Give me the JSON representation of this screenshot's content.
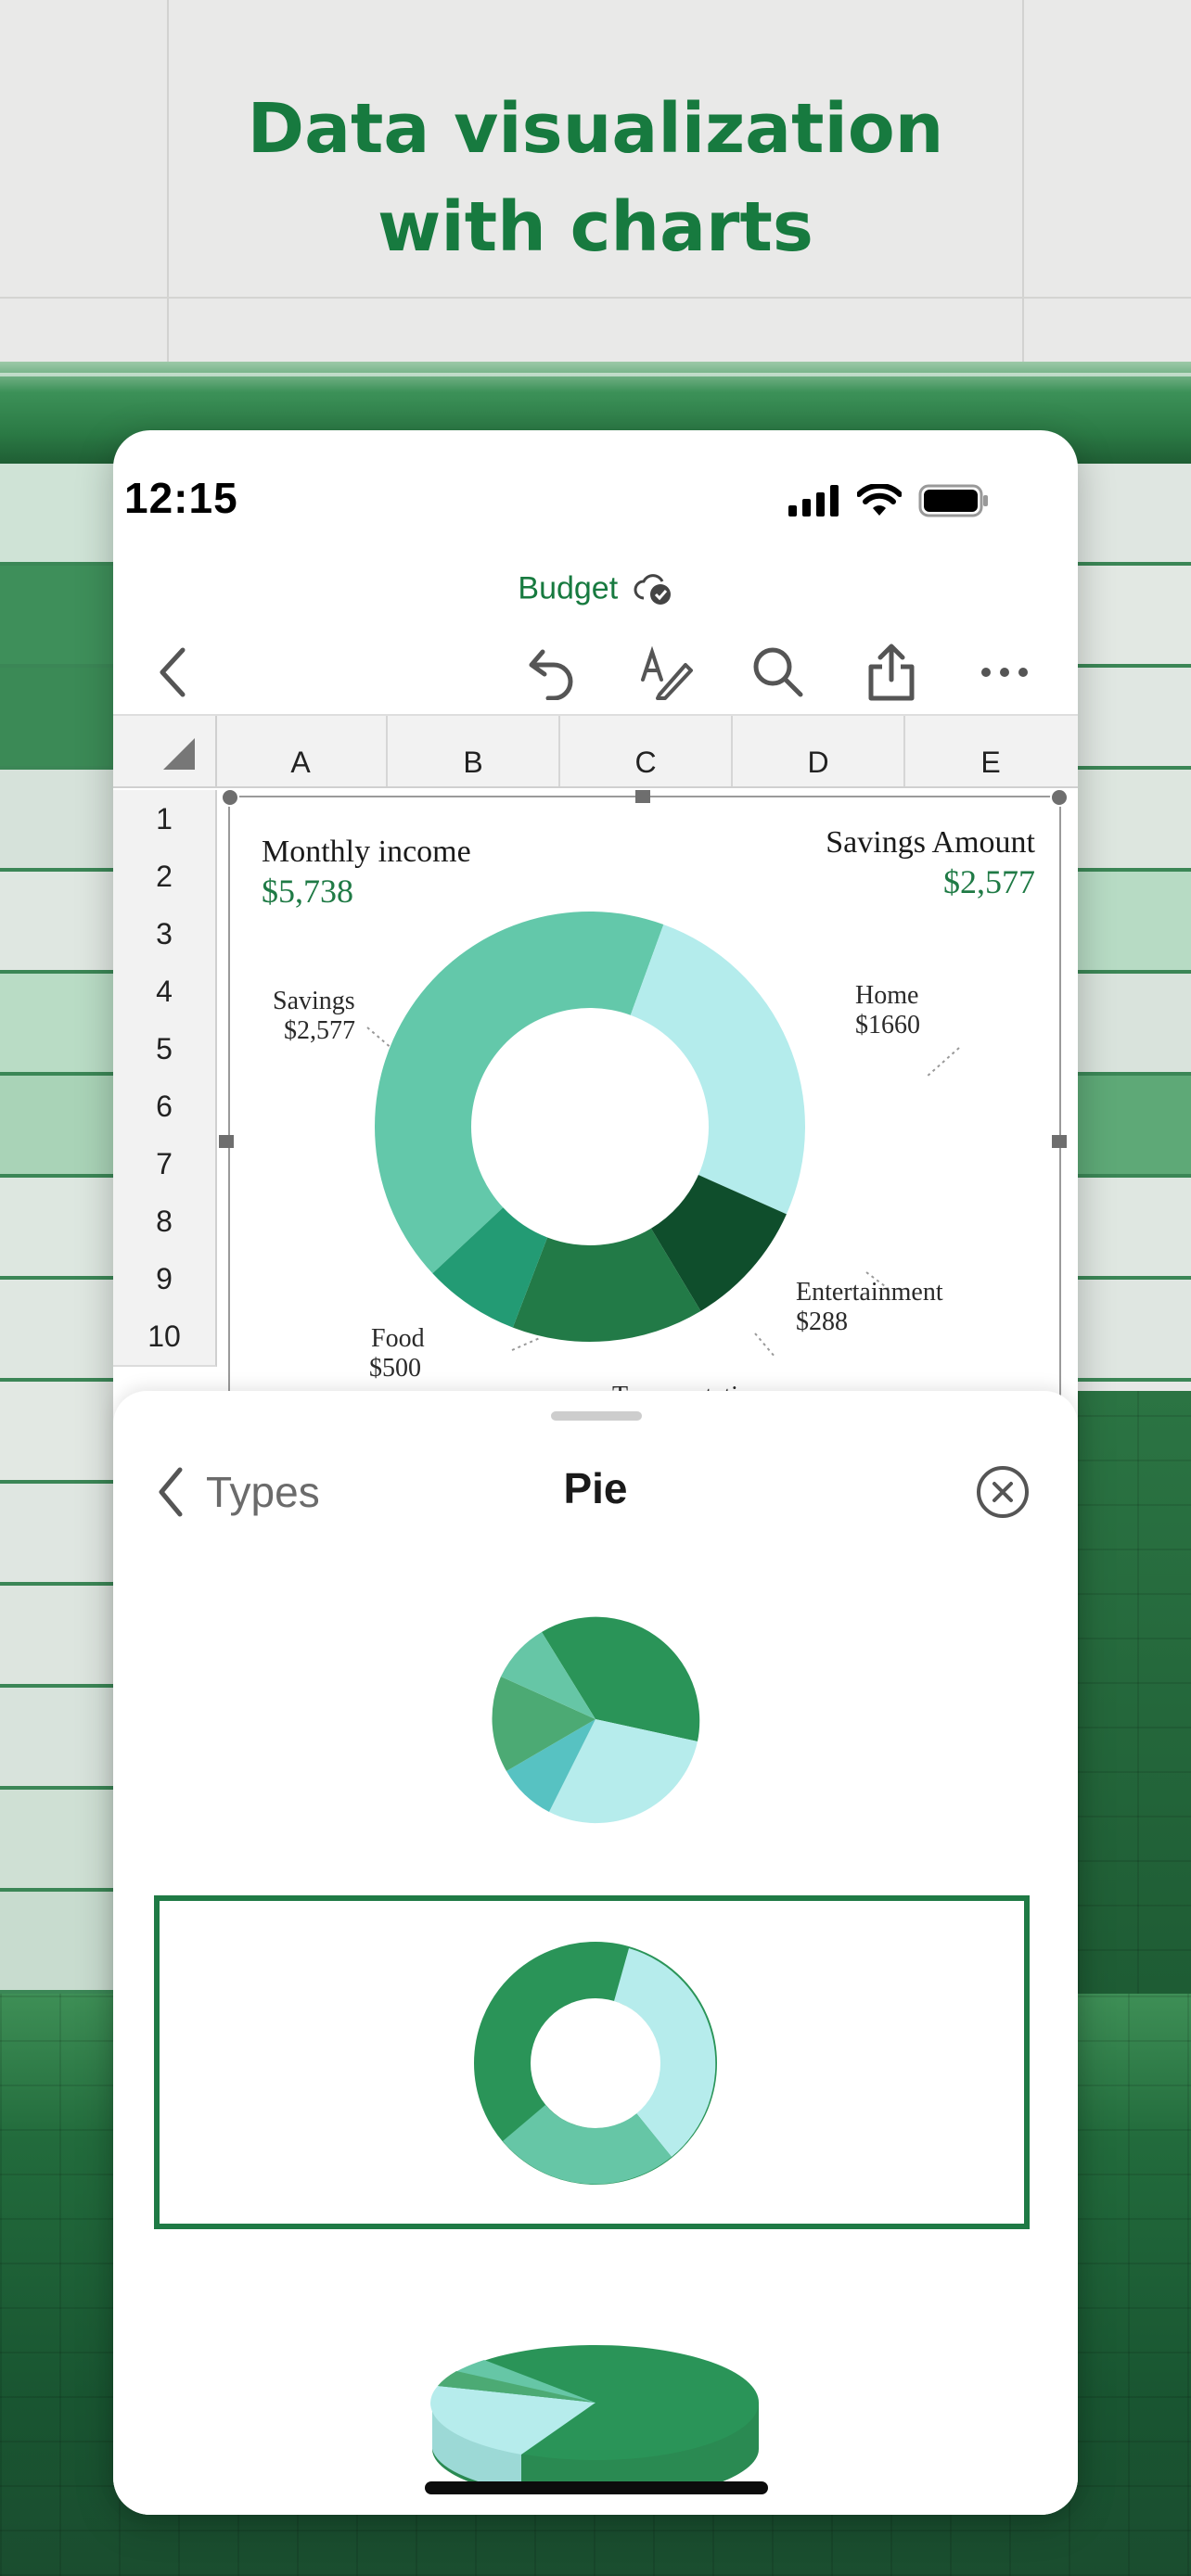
{
  "headline": {
    "line1": "Data visualization",
    "line2": "with charts"
  },
  "status_bar": {
    "time": "12:15",
    "icons": [
      "signal-icon",
      "wifi-icon",
      "battery-icon"
    ]
  },
  "document": {
    "title": "Budget",
    "sync_icon": "cloud-check-icon"
  },
  "toolbar": {
    "icons": [
      "back-icon",
      "undo-icon",
      "draw-icon",
      "search-icon",
      "share-icon",
      "more-icon"
    ]
  },
  "spreadsheet": {
    "columns": [
      "A",
      "B",
      "C",
      "D",
      "E"
    ],
    "rows": [
      "1",
      "2",
      "3",
      "4",
      "5",
      "6",
      "7",
      "8",
      "9",
      "10"
    ]
  },
  "chart": {
    "income_label": "Monthly income",
    "income_value": "$5,738",
    "savings_label": "Savings Amount",
    "savings_value": "$2,577",
    "slice_labels": {
      "savings": {
        "name": "Savings",
        "value": "$2,577"
      },
      "home": {
        "name": "Home",
        "value": "$1660"
      },
      "entertainment": {
        "name": "Entertainment",
        "value": "$288"
      },
      "food": {
        "name": "Food",
        "value": "$500"
      },
      "transportation": {
        "name": "Transportation",
        "value": ""
      }
    },
    "colors": {
      "savings": "#63c8aa",
      "home": "#b4ecec",
      "entertainment": "#0f4e2c",
      "transportation": "#227a47",
      "food": "#239b74"
    }
  },
  "chart_data": {
    "type": "pie",
    "title": "Monthly income",
    "subtitle": "$5,738",
    "categories": [
      "Savings",
      "Home",
      "Entertainment",
      "Transportation",
      "Food"
    ],
    "values": [
      2577,
      1660,
      288,
      null,
      500
    ],
    "donut": true,
    "legend": "none"
  },
  "panel": {
    "back_label": "Types",
    "title": "Pie",
    "options": [
      "pie-chart-option",
      "donut-chart-option",
      "3d-pie-chart-option"
    ],
    "selected": "donut-chart-option",
    "accent": "#1f7a45"
  }
}
